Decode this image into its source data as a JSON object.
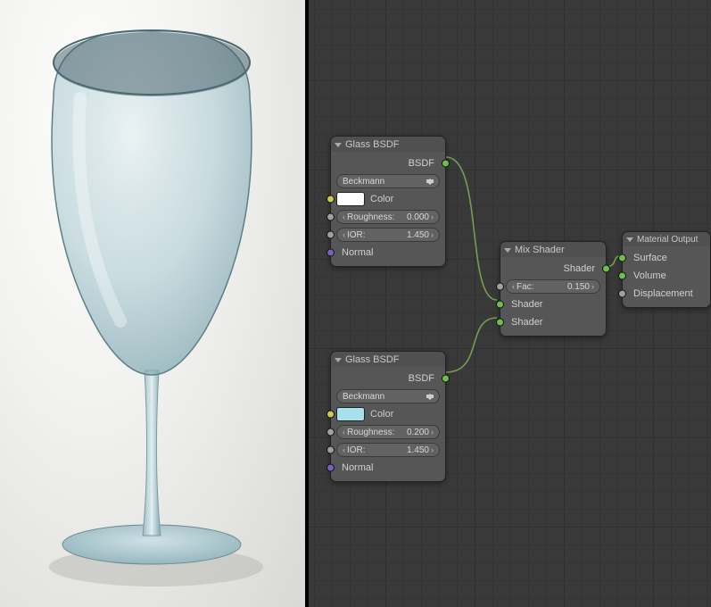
{
  "render": {
    "object": "wine-glass",
    "tint": "#b8d2da"
  },
  "nodes": {
    "glass1": {
      "title": "Glass BSDF",
      "out": "BSDF",
      "distribution": "Beckmann",
      "color_label": "Color",
      "color_value": "#ffffff",
      "roughness_label": "Roughness:",
      "roughness_value": "0.000",
      "ior_label": "IOR:",
      "ior_value": "1.450",
      "normal_label": "Normal"
    },
    "glass2": {
      "title": "Glass BSDF",
      "out": "BSDF",
      "distribution": "Beckmann",
      "color_label": "Color",
      "color_value": "#a7e2ec",
      "roughness_label": "Roughness:",
      "roughness_value": "0.200",
      "ior_label": "IOR:",
      "ior_value": "1.450",
      "normal_label": "Normal"
    },
    "mix": {
      "title": "Mix Shader",
      "out": "Shader",
      "fac_label": "Fac:",
      "fac_value": "0.150",
      "in1": "Shader",
      "in2": "Shader"
    },
    "output": {
      "title": "Material Output",
      "surface": "Surface",
      "volume": "Volume",
      "displacement": "Displacement"
    }
  },
  "colors": {
    "node_bg": "#565656",
    "panel_bg": "#393939",
    "wire": "#7aa65a"
  }
}
